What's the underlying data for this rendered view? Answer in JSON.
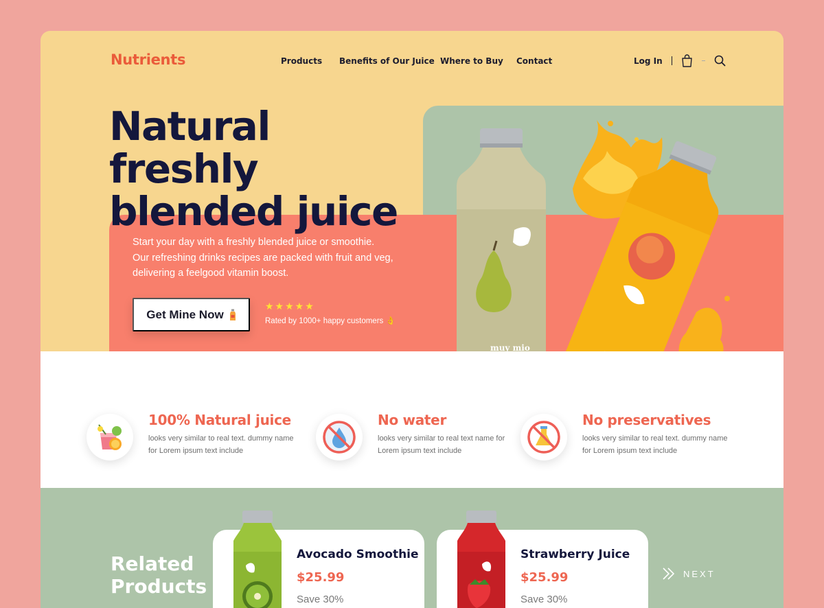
{
  "brand": {
    "logo": "Nutrients"
  },
  "nav": {
    "items": [
      "Products",
      "Benefits of Our Juice",
      "Where to Buy",
      "Contact"
    ],
    "login": "Log In"
  },
  "hero": {
    "title_line1": "Natural freshly",
    "title_line2": "blended juice",
    "description": "Start your day with a freshly blended juice or smoothie. Our refreshing drinks recipes are packed with fruit and veg, delivering a feelgood vitamin boost.",
    "cta_label": "Get Mine Now",
    "stars": "★★★★★",
    "rating_count": 5,
    "rating_text": "Rated by 1000+ happy customers 👌",
    "bottle_label": "muy mio"
  },
  "features": [
    {
      "title": "100% Natural juice",
      "desc": "looks very similar to real text. dummy name for Lorem ipsum text include"
    },
    {
      "title": "No water",
      "desc": "looks very similar to real text name for Lorem ipsum text include"
    },
    {
      "title": "No preservatives",
      "desc": "looks very similar to real text. dummy name for Lorem ipsum text include"
    }
  ],
  "related": {
    "title_line1": "Related",
    "title_line2": "Products",
    "products": [
      {
        "name": "Avocado Smoothie",
        "price": "$25.99",
        "save": "Save 30%"
      },
      {
        "name": "Strawberry Juice",
        "price": "$25.99",
        "save": "Save 30%"
      }
    ],
    "next_label": "NEXT"
  },
  "colors": {
    "background": "#f0a59d",
    "yellow": "#f7d68f",
    "green": "#adc4a9",
    "coral": "#f87f6c",
    "accent": "#ee6651",
    "navy": "#14173c"
  },
  "icons": [
    "cart-icon",
    "search-icon",
    "juice-glass-icon",
    "no-water-icon",
    "no-preservatives-icon",
    "chevrons-right-icon"
  ]
}
